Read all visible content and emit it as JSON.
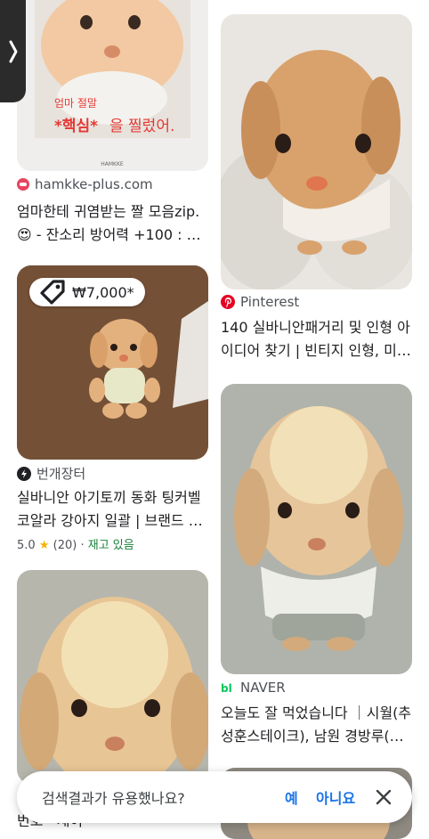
{
  "nav": {
    "side_panel_icon": "chevron-right-icon"
  },
  "results": [
    {
      "image_overlay": {
        "line1": "엄마 절말",
        "line2_em": "*핵심*",
        "line2_rest": "을 찔렀어.",
        "brand": "HAMKKE"
      },
      "source": "hamkke-plus.com",
      "source_icon": "hamkke-logo-icon",
      "title_line1": "엄마한테 귀염받는 짤 모음zip.",
      "title_line2": "😍 - 잔소리 방어력 +100 : …"
    },
    {
      "source": "Pinterest",
      "source_icon": "pinterest-logo-icon",
      "title_line1": "140 실바니안패거리 및 인형 아",
      "title_line2": "이디어 찾기 | 빈티지 인형, 미…"
    },
    {
      "price": "₩7,000*",
      "price_icon": "price-tag-icon",
      "source": "번개장터",
      "source_icon": "bunjang-logo-icon",
      "title_line1": "실바니안 아기토끼 동화 팅커벨",
      "title_line2": "코알라 강아지 일괄 | 브랜드 …",
      "rating": "5.0",
      "reviews": "(20)",
      "separator": "·",
      "stock": "재고 있음"
    },
    {
      "source": "NAVER",
      "source_icon": "naver-logo-icon",
      "title_line1": "오늘도 잘 먹었습니다 ｜시월(추",
      "title_line2": "성훈스테이크), 남원 경방루(…"
    },
    {
      "source": "",
      "title_line1": ""
    }
  ],
  "feedback": {
    "question": "검색결과가 유용했나요?",
    "yes": "예",
    "no": "아니요",
    "close_icon": "close-icon"
  },
  "partial_text": "번호 · 재이"
}
